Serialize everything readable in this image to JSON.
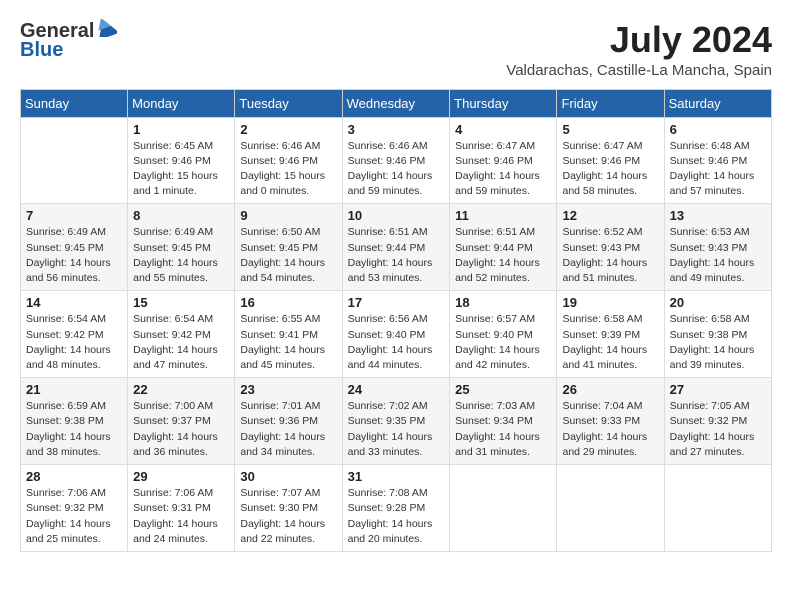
{
  "header": {
    "logo_general": "General",
    "logo_blue": "Blue",
    "month_year": "July 2024",
    "location": "Valdarachas, Castille-La Mancha, Spain"
  },
  "weekdays": [
    "Sunday",
    "Monday",
    "Tuesday",
    "Wednesday",
    "Thursday",
    "Friday",
    "Saturday"
  ],
  "weeks": [
    [
      {
        "day": "",
        "info": ""
      },
      {
        "day": "1",
        "info": "Sunrise: 6:45 AM\nSunset: 9:46 PM\nDaylight: 15 hours\nand 1 minute."
      },
      {
        "day": "2",
        "info": "Sunrise: 6:46 AM\nSunset: 9:46 PM\nDaylight: 15 hours\nand 0 minutes."
      },
      {
        "day": "3",
        "info": "Sunrise: 6:46 AM\nSunset: 9:46 PM\nDaylight: 14 hours\nand 59 minutes."
      },
      {
        "day": "4",
        "info": "Sunrise: 6:47 AM\nSunset: 9:46 PM\nDaylight: 14 hours\nand 59 minutes."
      },
      {
        "day": "5",
        "info": "Sunrise: 6:47 AM\nSunset: 9:46 PM\nDaylight: 14 hours\nand 58 minutes."
      },
      {
        "day": "6",
        "info": "Sunrise: 6:48 AM\nSunset: 9:46 PM\nDaylight: 14 hours\nand 57 minutes."
      }
    ],
    [
      {
        "day": "7",
        "info": "Sunrise: 6:49 AM\nSunset: 9:45 PM\nDaylight: 14 hours\nand 56 minutes."
      },
      {
        "day": "8",
        "info": "Sunrise: 6:49 AM\nSunset: 9:45 PM\nDaylight: 14 hours\nand 55 minutes."
      },
      {
        "day": "9",
        "info": "Sunrise: 6:50 AM\nSunset: 9:45 PM\nDaylight: 14 hours\nand 54 minutes."
      },
      {
        "day": "10",
        "info": "Sunrise: 6:51 AM\nSunset: 9:44 PM\nDaylight: 14 hours\nand 53 minutes."
      },
      {
        "day": "11",
        "info": "Sunrise: 6:51 AM\nSunset: 9:44 PM\nDaylight: 14 hours\nand 52 minutes."
      },
      {
        "day": "12",
        "info": "Sunrise: 6:52 AM\nSunset: 9:43 PM\nDaylight: 14 hours\nand 51 minutes."
      },
      {
        "day": "13",
        "info": "Sunrise: 6:53 AM\nSunset: 9:43 PM\nDaylight: 14 hours\nand 49 minutes."
      }
    ],
    [
      {
        "day": "14",
        "info": "Sunrise: 6:54 AM\nSunset: 9:42 PM\nDaylight: 14 hours\nand 48 minutes."
      },
      {
        "day": "15",
        "info": "Sunrise: 6:54 AM\nSunset: 9:42 PM\nDaylight: 14 hours\nand 47 minutes."
      },
      {
        "day": "16",
        "info": "Sunrise: 6:55 AM\nSunset: 9:41 PM\nDaylight: 14 hours\nand 45 minutes."
      },
      {
        "day": "17",
        "info": "Sunrise: 6:56 AM\nSunset: 9:40 PM\nDaylight: 14 hours\nand 44 minutes."
      },
      {
        "day": "18",
        "info": "Sunrise: 6:57 AM\nSunset: 9:40 PM\nDaylight: 14 hours\nand 42 minutes."
      },
      {
        "day": "19",
        "info": "Sunrise: 6:58 AM\nSunset: 9:39 PM\nDaylight: 14 hours\nand 41 minutes."
      },
      {
        "day": "20",
        "info": "Sunrise: 6:58 AM\nSunset: 9:38 PM\nDaylight: 14 hours\nand 39 minutes."
      }
    ],
    [
      {
        "day": "21",
        "info": "Sunrise: 6:59 AM\nSunset: 9:38 PM\nDaylight: 14 hours\nand 38 minutes."
      },
      {
        "day": "22",
        "info": "Sunrise: 7:00 AM\nSunset: 9:37 PM\nDaylight: 14 hours\nand 36 minutes."
      },
      {
        "day": "23",
        "info": "Sunrise: 7:01 AM\nSunset: 9:36 PM\nDaylight: 14 hours\nand 34 minutes."
      },
      {
        "day": "24",
        "info": "Sunrise: 7:02 AM\nSunset: 9:35 PM\nDaylight: 14 hours\nand 33 minutes."
      },
      {
        "day": "25",
        "info": "Sunrise: 7:03 AM\nSunset: 9:34 PM\nDaylight: 14 hours\nand 31 minutes."
      },
      {
        "day": "26",
        "info": "Sunrise: 7:04 AM\nSunset: 9:33 PM\nDaylight: 14 hours\nand 29 minutes."
      },
      {
        "day": "27",
        "info": "Sunrise: 7:05 AM\nSunset: 9:32 PM\nDaylight: 14 hours\nand 27 minutes."
      }
    ],
    [
      {
        "day": "28",
        "info": "Sunrise: 7:06 AM\nSunset: 9:32 PM\nDaylight: 14 hours\nand 25 minutes."
      },
      {
        "day": "29",
        "info": "Sunrise: 7:06 AM\nSunset: 9:31 PM\nDaylight: 14 hours\nand 24 minutes."
      },
      {
        "day": "30",
        "info": "Sunrise: 7:07 AM\nSunset: 9:30 PM\nDaylight: 14 hours\nand 22 minutes."
      },
      {
        "day": "31",
        "info": "Sunrise: 7:08 AM\nSunset: 9:28 PM\nDaylight: 14 hours\nand 20 minutes."
      },
      {
        "day": "",
        "info": ""
      },
      {
        "day": "",
        "info": ""
      },
      {
        "day": "",
        "info": ""
      }
    ]
  ]
}
